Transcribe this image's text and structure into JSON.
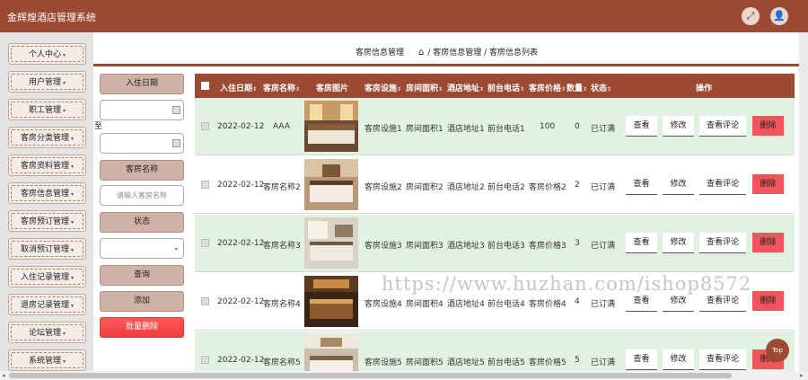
{
  "app": {
    "title": "金辉煌酒店管理系统"
  },
  "header": {
    "fullscreen_icon": "expand-icon",
    "user_icon": "user-icon"
  },
  "sidebar": {
    "items": [
      {
        "label": "个人中心"
      },
      {
        "label": "用户管理"
      },
      {
        "label": "职工管理"
      },
      {
        "label": "客房分类管理"
      },
      {
        "label": "客房资料管理"
      },
      {
        "label": "客房信息管理"
      },
      {
        "label": "客房预订管理"
      },
      {
        "label": "取消预订管理"
      },
      {
        "label": "入住记录管理"
      },
      {
        "label": "退房记录管理"
      },
      {
        "label": "论坛管理"
      },
      {
        "label": "系统管理"
      }
    ]
  },
  "breadcrumb": {
    "page_title": "客房信息管理",
    "trail": "/ 客房信息管理 / 客房信息列表"
  },
  "filters": {
    "checkin_label": "入住日期",
    "to_label": "至",
    "room_name_label": "客房名称",
    "room_name_placeholder": "请输入客房名称",
    "status_label": "状态",
    "status_value": "",
    "search_button": "查询",
    "add_button": "添加",
    "batch_delete_button": "批量删除"
  },
  "table": {
    "columns": [
      "入住日期",
      "客房名称",
      "客房图片",
      "客房设施",
      "房间面积",
      "酒店地址",
      "前台电话",
      "客房价格",
      "数量",
      "状态",
      "操作"
    ],
    "actions": {
      "view": "查看",
      "edit": "修改",
      "review": "查看评论",
      "delete": "删除"
    },
    "rows": [
      {
        "date": "2022-02-12",
        "name": "AAA",
        "facility": "客房设施1",
        "area": "房间面积1",
        "address": "酒店地址1",
        "phone": "前台电话1",
        "price": "100",
        "count": "0",
        "status": "已订满"
      },
      {
        "date": "2022-02-12",
        "name": "客房名称2",
        "facility": "客房设施2",
        "area": "房间面积2",
        "address": "酒店地址2",
        "phone": "前台电话2",
        "price": "客房价格2",
        "count": "2",
        "status": "已订满"
      },
      {
        "date": "2022-02-12",
        "name": "客房名称3",
        "facility": "客房设施3",
        "area": "房间面积3",
        "address": "酒店地址3",
        "phone": "前台电话3",
        "price": "客房价格3",
        "count": "3",
        "status": "已订满"
      },
      {
        "date": "2022-02-12",
        "name": "客房名称4",
        "facility": "客房设施4",
        "area": "房间面积4",
        "address": "酒店地址4",
        "phone": "前台电话4",
        "price": "客房价格4",
        "count": "4",
        "status": "已订满"
      },
      {
        "date": "2022-02-12",
        "name": "客房名称5",
        "facility": "客房设施5",
        "area": "房间面积5",
        "address": "酒店地址5",
        "phone": "前台电话5",
        "price": "客房价格5",
        "count": "5",
        "status": "已订满"
      }
    ]
  },
  "watermark": "https://www.huzhan.com/ishop8572",
  "top_button": "Top",
  "colors": {
    "brand": "#9c4a32",
    "row_alt": "#e2f2e2",
    "danger": "#f2545b"
  }
}
